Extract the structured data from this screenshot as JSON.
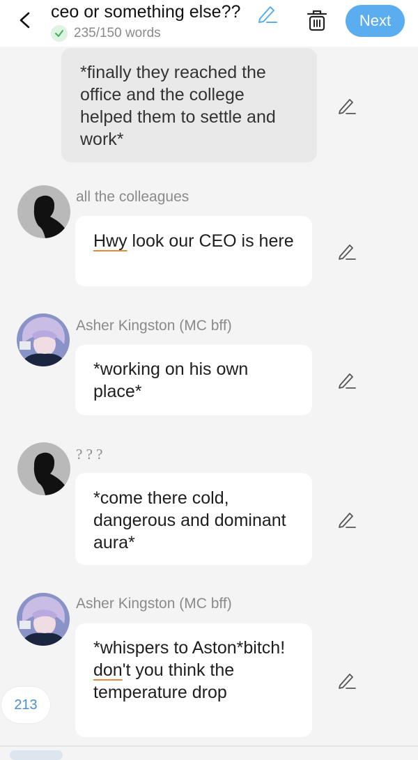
{
  "header": {
    "title": "ceo or something else??",
    "word_count": "235/150 words",
    "next_label": "Next",
    "accent_color": "#5aaef0"
  },
  "messages": [
    {
      "type": "narration",
      "text": "*finally they reached the office and the college helped them to settle and work*"
    },
    {
      "type": "dialogue",
      "character": "all the colleagues",
      "avatar": "silhouette-avatar",
      "text_typo": "Hwy",
      "text_rest": " look our CEO is here"
    },
    {
      "type": "dialogue",
      "character": "Asher Kingston (MC bff)",
      "avatar": "anime-character-avatar",
      "text": "*working on his own place*"
    },
    {
      "type": "dialogue",
      "character": "? ? ?",
      "avatar": "silhouette-avatar",
      "text": "*come there cold, dangerous and dominant aura*"
    },
    {
      "type": "dialogue",
      "character": "Asher Kingston (MC bff)",
      "avatar": "anime-character-avatar",
      "text_part1": "*whispers to Aston*bitch! ",
      "text_typo": "don",
      "text_part2": "'t you think the temperature drop"
    }
  ],
  "counter": "213"
}
